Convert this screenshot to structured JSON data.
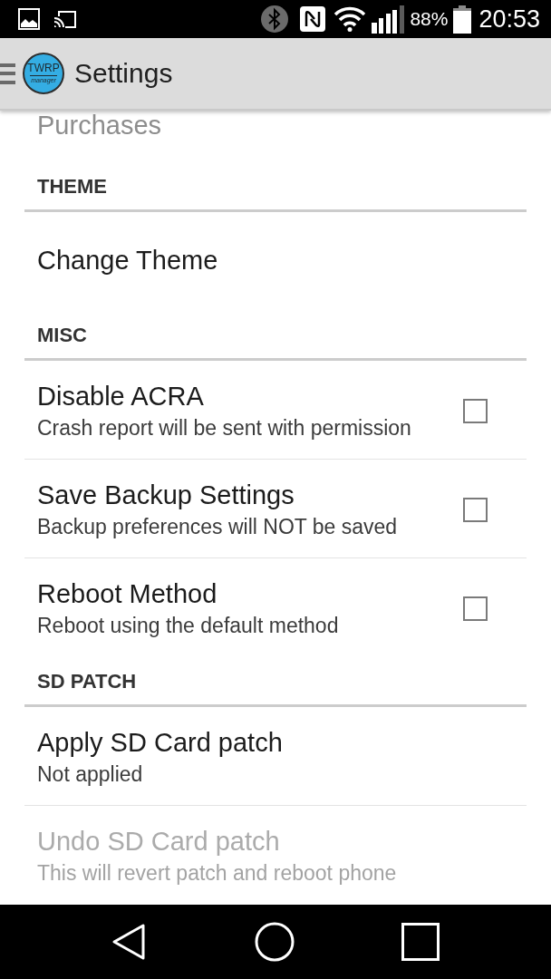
{
  "status_bar": {
    "battery_percent": "88%",
    "time": "20:53"
  },
  "app_bar": {
    "logo": {
      "text": "TWRP",
      "subtext": "manager"
    },
    "title": "Settings"
  },
  "cut_off_item": {
    "title": "Purchases"
  },
  "sections": [
    {
      "header": "THEME",
      "items": [
        {
          "kind": "plain",
          "title": "Change Theme",
          "disabled": false
        }
      ]
    },
    {
      "header": "MISC",
      "items": [
        {
          "kind": "checkbox",
          "title": "Disable ACRA",
          "summary": "Crash report will be sent with permission",
          "checked": false,
          "disabled": false
        },
        {
          "kind": "checkbox",
          "title": "Save Backup Settings",
          "summary": "Backup preferences will NOT be saved",
          "checked": false,
          "disabled": false
        },
        {
          "kind": "checkbox",
          "title": "Reboot Method",
          "summary": "Reboot using the default method",
          "checked": false,
          "disabled": false
        }
      ]
    },
    {
      "header": "SD PATCH",
      "items": [
        {
          "kind": "plain",
          "title": "Apply SD Card patch",
          "summary": "Not applied",
          "disabled": false
        },
        {
          "kind": "plain",
          "title": "Undo SD Card patch",
          "summary": "This will revert patch and reboot phone",
          "disabled": true
        }
      ]
    }
  ]
}
